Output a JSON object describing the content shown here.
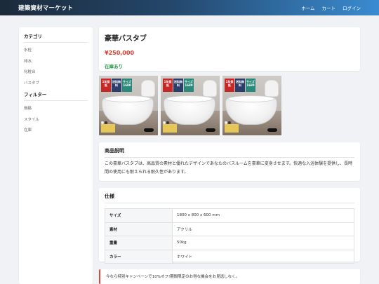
{
  "nav": {
    "brand": "建築資材マーケット",
    "links": [
      "ホーム",
      "カート",
      "ログイン"
    ]
  },
  "sidebar": {
    "category_heading": "カテゴリ",
    "categories": [
      "水栓",
      "排水",
      "化粧台",
      "バスタブ"
    ],
    "filter_heading": "フィルター",
    "filters": [
      "価格",
      "スタイル",
      "在庫"
    ]
  },
  "product": {
    "name": "豪華バスタブ",
    "price": "¥250,000",
    "stock": "在庫あり"
  },
  "gallery": {
    "badges": [
      "1年保証",
      "送料無料",
      "サイズ1680"
    ],
    "count": 3
  },
  "description": {
    "heading": "商品説明",
    "text": "この豪華バスタブは、高品質の素材と優れたデザインであなたのバスルームを豪華に変身させます。快適な入浴体験を提供し、長時間の使用にも耐えられる耐久性があります。"
  },
  "specs": {
    "heading": "仕様",
    "rows": [
      {
        "key": "サイズ",
        "value": "1800 x 800 x 600 mm"
      },
      {
        "key": "素材",
        "value": "アクリル"
      },
      {
        "key": "重量",
        "value": "50kg"
      },
      {
        "key": "カラー",
        "value": "ホワイト"
      }
    ]
  },
  "notice": {
    "text": "今なら特別キャンペーンで10%オフ!期間限定のお得な機会をお見逃しなく。"
  },
  "colors": {
    "price": "#d93a2b",
    "stock": "#2e9d4c",
    "notice_accent": "#e0463a"
  }
}
